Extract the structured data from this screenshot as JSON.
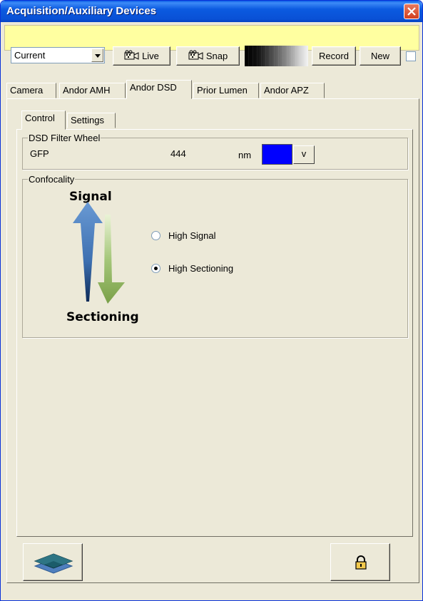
{
  "window": {
    "title": "Acquisition/Auxiliary Devices"
  },
  "toolbar": {
    "preset_value": "Current",
    "live_label": "Live",
    "snap_label": "Snap",
    "record_label": "Record",
    "new_label": "New"
  },
  "tabs": [
    {
      "label": "Camera"
    },
    {
      "label": "Andor AMH"
    },
    {
      "label": "Andor DSD",
      "active": true
    },
    {
      "label": "Prior Lumen"
    },
    {
      "label": "Andor APZ"
    }
  ],
  "subtabs": [
    {
      "label": "Control",
      "active": true
    },
    {
      "label": "Settings"
    }
  ],
  "filter_wheel": {
    "title": "DSD Filter Wheel",
    "filter_name": "GFP",
    "wavelength": "444",
    "unit": "nm",
    "swatch_color": "#0000ff",
    "dropdown_label": "v"
  },
  "confocality": {
    "title": "Confocality",
    "signal_label": "Signal",
    "sectioning_label": "Sectioning",
    "options": [
      {
        "label": "High Signal",
        "checked": false
      },
      {
        "label": "High Sectioning",
        "checked": true
      }
    ],
    "signal_arrow_color": "#3c6fb0",
    "sectioning_arrow_color": "#8cae5a"
  },
  "bottom": {
    "left_icon": "layers-icon",
    "right_icon": "padlock-icon"
  },
  "colors": {
    "titlebar": "#0a5ee6",
    "toolbar_bg": "#ffffa0",
    "window_bg": "#ece9d8",
    "close": "#d1401f"
  }
}
